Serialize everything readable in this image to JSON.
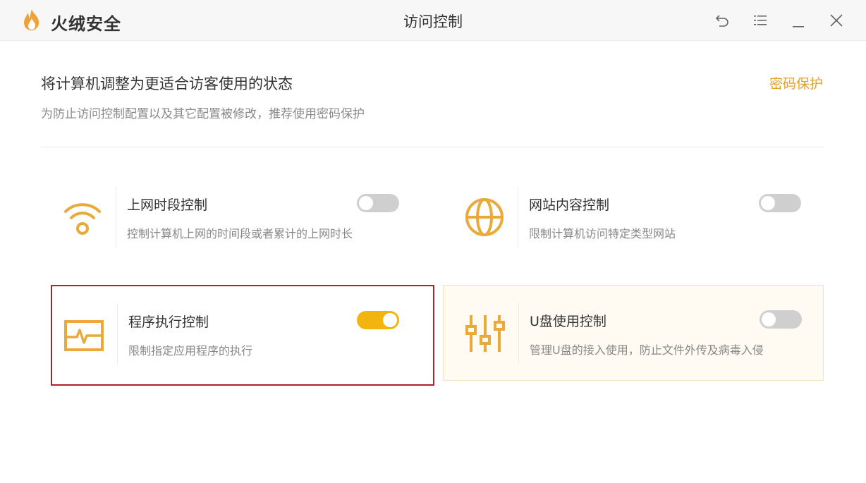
{
  "app": {
    "brand": "火绒安全",
    "window_title": "访问控制"
  },
  "header": {
    "headline": "将计算机调整为更适合访客使用的状态",
    "subline": "为防止访问控制配置以及其它配置被修改，推荐使用密码保护",
    "password_link": "密码保护"
  },
  "controls": [
    {
      "name": "上网时段控制",
      "desc": "控制计算机上网的时间段或者累计的上网时长",
      "icon": "wifi-icon",
      "enabled": false
    },
    {
      "name": "网站内容控制",
      "desc": "限制计算机访问特定类型网站",
      "icon": "globe-icon",
      "enabled": false
    },
    {
      "name": "程序执行控制",
      "desc": "限制指定应用程序的执行",
      "icon": "monitor-pulse-icon",
      "enabled": true
    },
    {
      "name": "U盘使用控制",
      "desc": "管理U盘的接入使用，防止文件外传及病毒入侵",
      "icon": "sliders-icon",
      "enabled": false
    }
  ],
  "colors": {
    "accent": "#f4b40f",
    "icon": "#e9aa3a",
    "link": "#e2a12c",
    "selection_border": "#b01f2c"
  }
}
